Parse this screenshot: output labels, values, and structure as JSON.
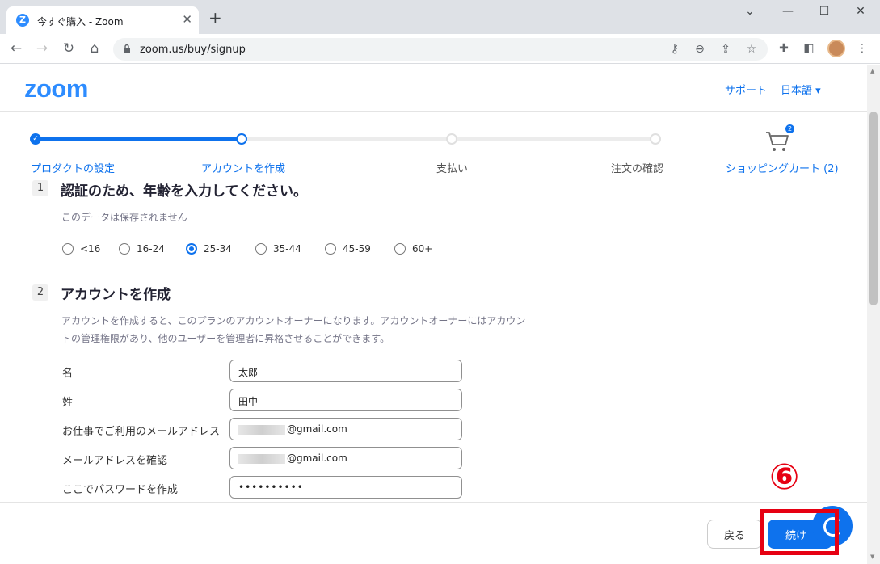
{
  "browser": {
    "tab_title": "今すぐ購入 - Zoom",
    "favicon_letter": "Z",
    "tab_close": "✕",
    "new_tab": "+",
    "url": "zoom.us/buy/signup",
    "window_controls": [
      "⌄",
      "—",
      "☐",
      "✕"
    ]
  },
  "header": {
    "logo": "zoom",
    "support_link": "サポート",
    "language": "日本語 ▾"
  },
  "progress": {
    "steps": [
      "プロダクトの設定",
      "アカウントを作成",
      "支払い",
      "注文の確認"
    ],
    "cart_label": "ショッピングカート (2)",
    "cart_count": "2"
  },
  "age_section": {
    "number": "1",
    "title": "認証のため、年齢を入力してください。",
    "note": "このデータは保存されません",
    "options": [
      "<16",
      "16-24",
      "25-34",
      "35-44",
      "45-59",
      "60+"
    ],
    "selected": "25-34"
  },
  "account_section": {
    "number": "2",
    "title": "アカウントを作成",
    "description_line1": "アカウントを作成すると、このプランのアカウントオーナーになります。アカウントオーナーにはアカウン",
    "description_line2": "トの管理権限があり、他のユーザーを管理者に昇格させることができます。",
    "fields": [
      {
        "label": "名",
        "value": "太郎"
      },
      {
        "label": "姓",
        "value": "田中"
      },
      {
        "label": "お仕事でご利用のメールアドレス",
        "value": "@gmail.com"
      },
      {
        "label": "メールアドレスを確認",
        "value": "@gmail.com"
      },
      {
        "label": "ここでパスワードを作成",
        "value": "••••••••••"
      }
    ]
  },
  "footer": {
    "back_label": "戻る",
    "next_label": "続け"
  },
  "annotation": {
    "marker": "⑥",
    "color": "#e60012"
  },
  "colors": {
    "accent": "#0e72ed",
    "brand": "#2d8cff"
  }
}
